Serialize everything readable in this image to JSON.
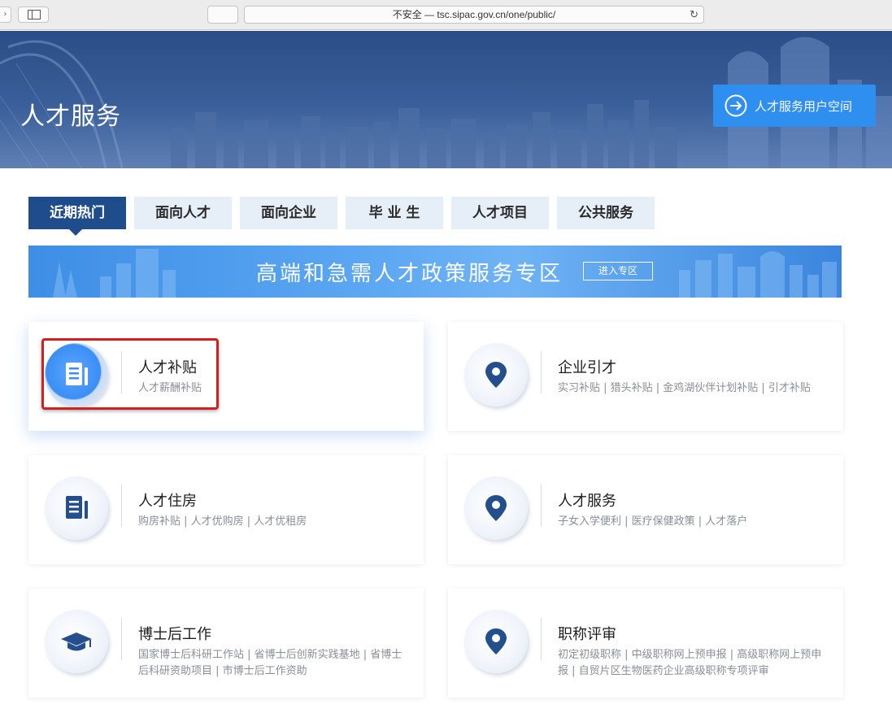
{
  "browser": {
    "back_label": "›",
    "url": "不安全 — tsc.sipac.gov.cn/one/public/",
    "reload_icon": "reload-icon"
  },
  "hero": {
    "title": "人才服务",
    "user_space_label": "人才服务用户空间"
  },
  "tabs": [
    {
      "label": "近期热门",
      "active": true
    },
    {
      "label": "面向人才",
      "active": false
    },
    {
      "label": "面向企业",
      "active": false
    },
    {
      "label": "毕 业 生",
      "active": false
    },
    {
      "label": "人才项目",
      "active": false
    },
    {
      "label": "公共服务",
      "active": false
    }
  ],
  "promo": {
    "text": "高端和急需人才政策服务专区",
    "enter_label": "进入专区"
  },
  "cards": [
    {
      "title": "人才补贴",
      "sub": "人才薪酬补贴",
      "icon": "document-icon"
    },
    {
      "title": "企业引才",
      "sub": "实习补贴 | 猎头补贴 |  金鸡湖伙伴计划补贴 | 引才补贴",
      "icon": "location-pin-icon"
    },
    {
      "title": "人才住房",
      "sub": "购房补贴 | 人才优购房 | 人才优租房",
      "icon": "document-icon"
    },
    {
      "title": "人才服务",
      "sub": "子女入学便利 | 医疗保健政策 | 人才落户",
      "icon": "location-pin-icon"
    },
    {
      "title": "博士后工作",
      "sub": "国家博士后科研工作站 | 省博士后创新实践基地 | 省博士后科研资助项目 | 市博士后工作资助",
      "icon": "graduation-cap-icon"
    },
    {
      "title": "职称评审",
      "sub": "初定初级职称 | 中级职称网上预申报 | 高级职称网上预申报 | 自贸片区生物医药企业高级职称专项评审",
      "icon": "location-pin-icon"
    }
  ],
  "colors": {
    "tab_active": "#1f4d8c",
    "tab_inactive": "#e6eef7",
    "accent_button": "#2f8ff0",
    "highlight_border": "#d3201e",
    "icon_dark": "#244f8d"
  }
}
